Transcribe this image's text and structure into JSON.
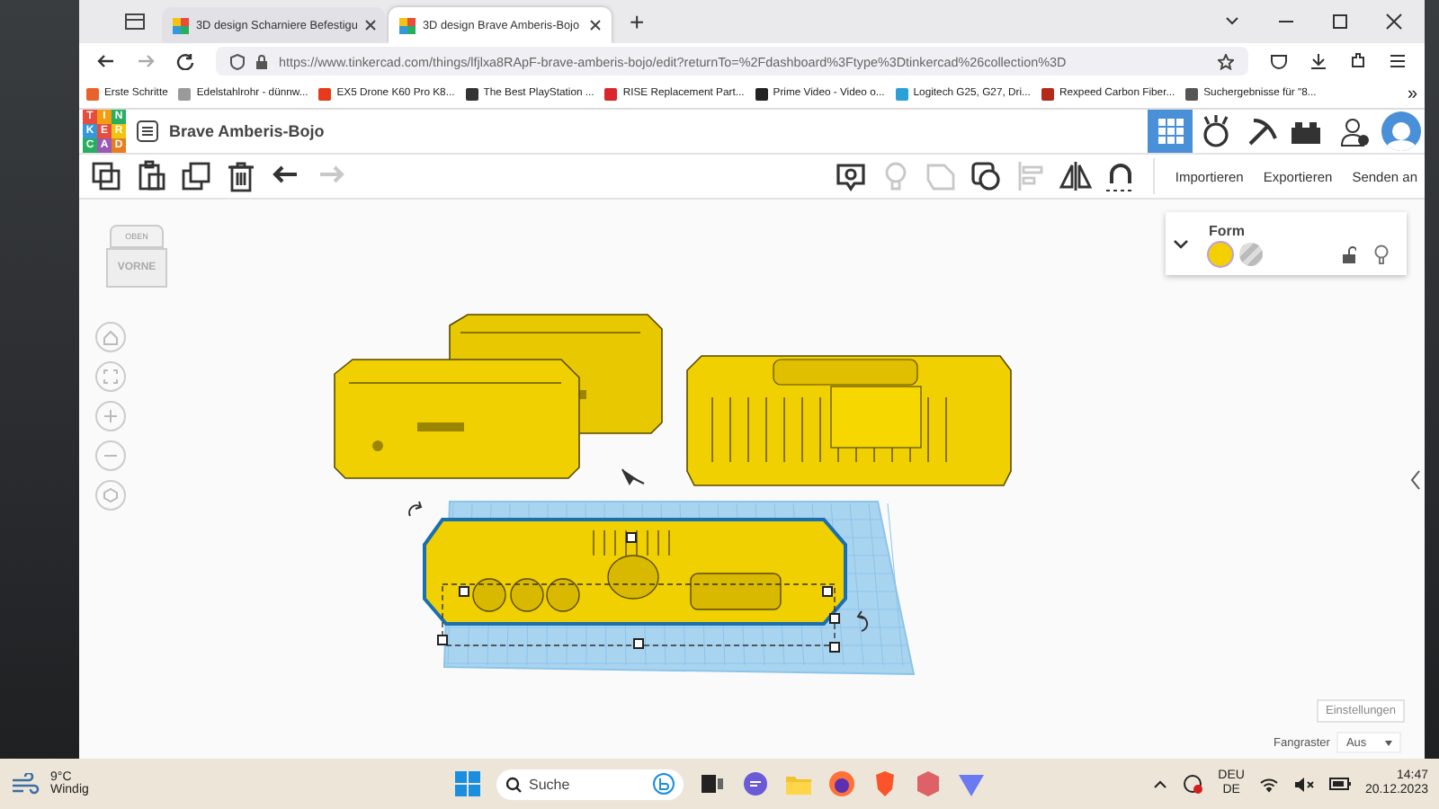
{
  "browser": {
    "tabs": [
      {
        "title": "3D design Scharniere Befestigu",
        "selected": false
      },
      {
        "title": "3D design Brave Amberis-Bojo",
        "selected": true
      }
    ],
    "new_tab": "+",
    "url": "https://www.tinkercad.com/things/lfjlxa8RApF-brave-amberis-bojo/edit?returnTo=%2Fdashboard%3Ftype%3Dtinkercad%26collection%3D",
    "bookmarks": [
      {
        "label": "Erste Schritte",
        "color": "#e8622c"
      },
      {
        "label": "Edelstahlrohr - dünnw...",
        "color": "#9a9a9a"
      },
      {
        "label": "EX5 Drone K60 Pro K8...",
        "color": "#e53a1c"
      },
      {
        "label": "The Best PlayStation ...",
        "color": "#333333"
      },
      {
        "label": "RISE Replacement Part...",
        "color": "#d8262c"
      },
      {
        "label": "Prime Video - Video o...",
        "color": "#222222"
      },
      {
        "label": "Logitech G25, G27, Dri...",
        "color": "#2a9fd8"
      },
      {
        "label": "Rexpeed Carbon Fiber...",
        "color": "#b22a1a"
      },
      {
        "label": "Suchergebnisse für \"8...",
        "color": "#555555"
      }
    ],
    "more_bookmarks": "»"
  },
  "app": {
    "logo": [
      "T",
      "I",
      "N",
      "K",
      "E",
      "R",
      "C",
      "A",
      "D"
    ],
    "project_title": "Brave Amberis-Bojo",
    "views": [
      {
        "kind": "grid",
        "selected": true
      },
      {
        "kind": "bricks",
        "selected": false
      },
      {
        "kind": "pickaxe",
        "selected": false
      },
      {
        "kind": "lego",
        "selected": false
      }
    ],
    "edit_tools": [
      {
        "kind": "copy",
        "disabled": false
      },
      {
        "kind": "paste",
        "disabled": false
      },
      {
        "kind": "duplicate",
        "disabled": false
      },
      {
        "kind": "delete",
        "disabled": false
      },
      {
        "kind": "undo",
        "disabled": false
      },
      {
        "kind": "redo",
        "disabled": true
      }
    ],
    "shape_tools": [
      {
        "kind": "note",
        "disabled": false
      },
      {
        "kind": "bulb",
        "disabled": true
      },
      {
        "kind": "group",
        "disabled": true
      },
      {
        "kind": "ungroup",
        "disabled": false
      },
      {
        "kind": "align",
        "disabled": true
      },
      {
        "kind": "mirror",
        "disabled": false
      },
      {
        "kind": "magnet",
        "disabled": false
      }
    ],
    "actions": [
      "Importieren",
      "Exportieren",
      "Senden an"
    ],
    "view_cube": {
      "top": "OBEN",
      "front": "VORNE"
    },
    "shape_panel": {
      "title": "Form",
      "modes": [
        {
          "kind": "solid",
          "selected": true
        },
        {
          "kind": "hole",
          "selected": false
        }
      ],
      "locked": false
    },
    "settings_button": "Einstellungen",
    "snap_grid": {
      "label": "Fangraster",
      "value": "Aus"
    }
  },
  "taskbar": {
    "temperature": "9°C",
    "weather": "Windig",
    "search_placeholder": "Suche",
    "language": "DEU",
    "layout": "DE",
    "time": "14:47",
    "date": "20.12.2023"
  }
}
